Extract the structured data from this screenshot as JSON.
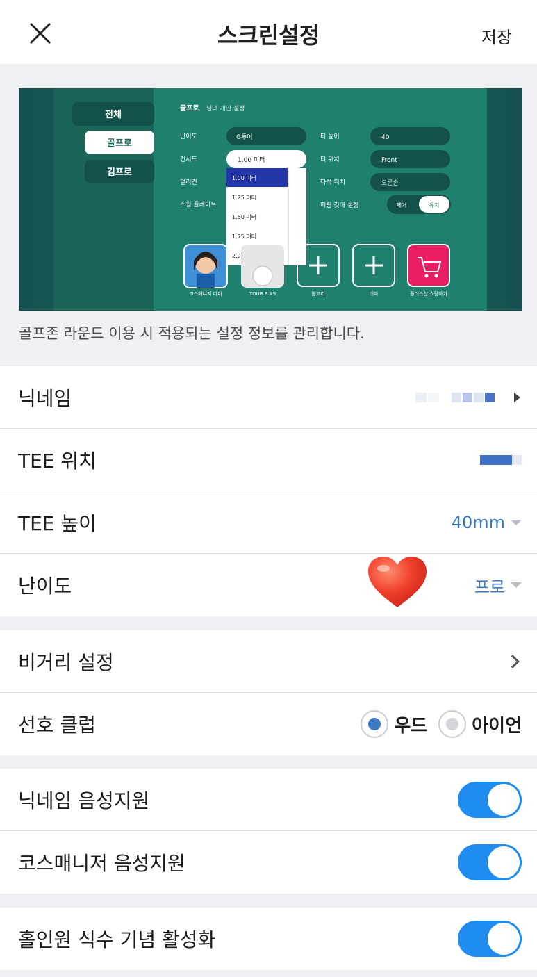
{
  "header": {
    "title": "스크린설정",
    "save_label": "저장",
    "close_icon": "close-icon"
  },
  "preview": {
    "caption": "골프존 라운드 이용 시 적용되는 설정 정보를 관리합니다.",
    "tabs": [
      "전체",
      "골프로",
      "김프로"
    ],
    "panel_title_a": "골프로",
    "panel_title_b": "님의 개인 설정",
    "settings": [
      {
        "label": "난이도",
        "value": "G투어"
      },
      {
        "label": "컨시드",
        "value": "1.00 미터"
      },
      {
        "label": "멀리건",
        "value": ""
      },
      {
        "label": "스윙 플레이트",
        "value": ""
      }
    ],
    "settings_right": [
      {
        "label": "티 높이",
        "value": "40"
      },
      {
        "label": "티 위치",
        "value": "Front"
      },
      {
        "label": "타석 위치",
        "value": "오른손"
      },
      {
        "label": "퍼팅 깃대 설정",
        "off": "제거",
        "on": "유지"
      }
    ],
    "dropdown_options": [
      "1.00 미터",
      "1.25 미터",
      "1.50 미터",
      "1.75 미터",
      "2.00 미터"
    ],
    "bottom_items": [
      "코스매니저 다미",
      "TOUR B XS",
      "볼꼬리",
      "테마",
      "플러스샵 쇼핑하기"
    ]
  },
  "rows_group1": {
    "nickname_label": "닉네임",
    "tee_position_label": "TEE 위치",
    "tee_height_label": "TEE 높이",
    "tee_height_value": "40mm",
    "difficulty_label": "난이도",
    "difficulty_value": "프로"
  },
  "rows_group2": {
    "distance_label": "비거리 설정",
    "club_label": "선호 클럽",
    "club_options": [
      "우드",
      "아이언"
    ]
  },
  "rows_group3": {
    "nickname_voice_label": "닉네임 음성지원",
    "nickname_voice_on": true,
    "course_manager_voice_label": "코스매니저 음성지원",
    "course_manager_voice_on": true
  },
  "rows_group4": {
    "hole_in_one_label": "홀인원 식수 기념 활성화",
    "hole_in_one_on": true
  },
  "colors": {
    "accent": "#1e8bef",
    "value_blue": "#3a78c2",
    "preview_green": "#1c6a62"
  }
}
